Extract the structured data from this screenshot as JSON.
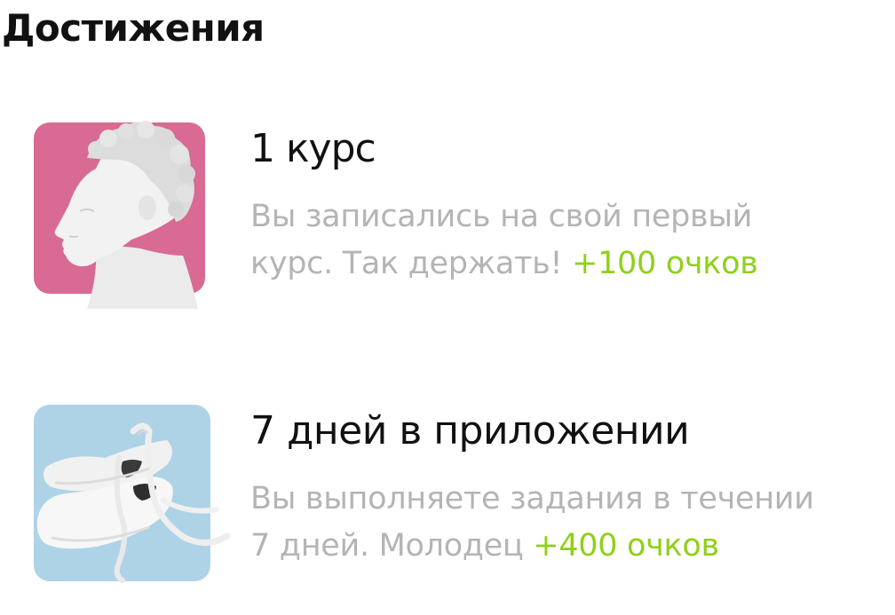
{
  "header": {
    "title": "Достижения"
  },
  "achievements": [
    {
      "icon": "apollo-bust-image",
      "background_color": "#d86a93",
      "title": "1 курс",
      "description_line1": "Вы записались на свой первый",
      "description_line2": "курс. Так держать!",
      "points": "+100 очков"
    },
    {
      "icon": "pointe-shoes-image",
      "background_color": "#aed3e7",
      "title": "7 дней в приложении",
      "description_line1": "Вы выполняете задания в течении",
      "description_line2": "7 дней. Молодец",
      "points": "+400 очков"
    }
  ],
  "colors": {
    "title_text": "#111111",
    "description_text": "#b4b4b4",
    "points_accent": "#8fd019"
  }
}
